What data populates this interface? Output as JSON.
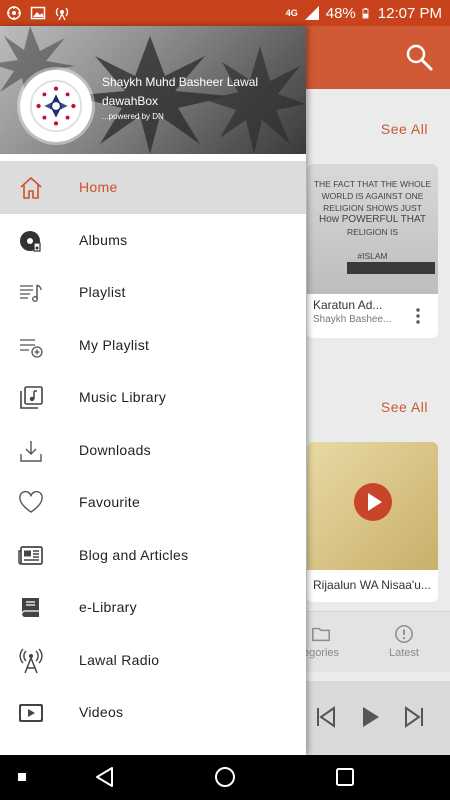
{
  "status_bar": {
    "network": "4G",
    "battery": "48%",
    "time": "12:07 PM"
  },
  "drawer": {
    "header": {
      "name": "Shaykh Muhd Basheer Lawal",
      "app": "dawahBox",
      "powered": "...powered by DN"
    },
    "items": [
      {
        "label": "Home",
        "icon": "home-icon",
        "active": true
      },
      {
        "label": "Albums",
        "icon": "album-disc-icon"
      },
      {
        "label": "Playlist",
        "icon": "playlist-icon"
      },
      {
        "label": "My Playlist",
        "icon": "add-playlist-icon"
      },
      {
        "label": "Music Library",
        "icon": "music-library-icon"
      },
      {
        "label": "Downloads",
        "icon": "download-icon"
      },
      {
        "label": "Favourite",
        "icon": "heart-icon"
      },
      {
        "label": "Blog and Articles",
        "icon": "newspaper-icon"
      },
      {
        "label": "e-Library",
        "icon": "book-icon"
      },
      {
        "label": "Lawal Radio",
        "icon": "radio-tower-icon"
      },
      {
        "label": "Videos",
        "icon": "video-icon"
      }
    ]
  },
  "background": {
    "see_all_1": "See All",
    "see_all_2": "See All",
    "card1": {
      "title": "Karatun Ad...",
      "subtitle": "Shaykh Bashee...",
      "quote_1": "THE FACT THAT THE WHOLE",
      "quote_2": "WORLD IS AGAINST ONE",
      "quote_3": "RELIGION SHOWS JUST",
      "quote_4": "How POWERFUL THAT",
      "quote_5": "RELIGION IS",
      "hashtag": "#ISLAM"
    },
    "card2": {
      "title": "Rijaalun WA Nisaa'u..."
    },
    "bottom_nav": {
      "categories": "egories",
      "latest": "Latest"
    }
  },
  "colors": {
    "accent": "#c8431b",
    "active_label": "#d0502c"
  }
}
